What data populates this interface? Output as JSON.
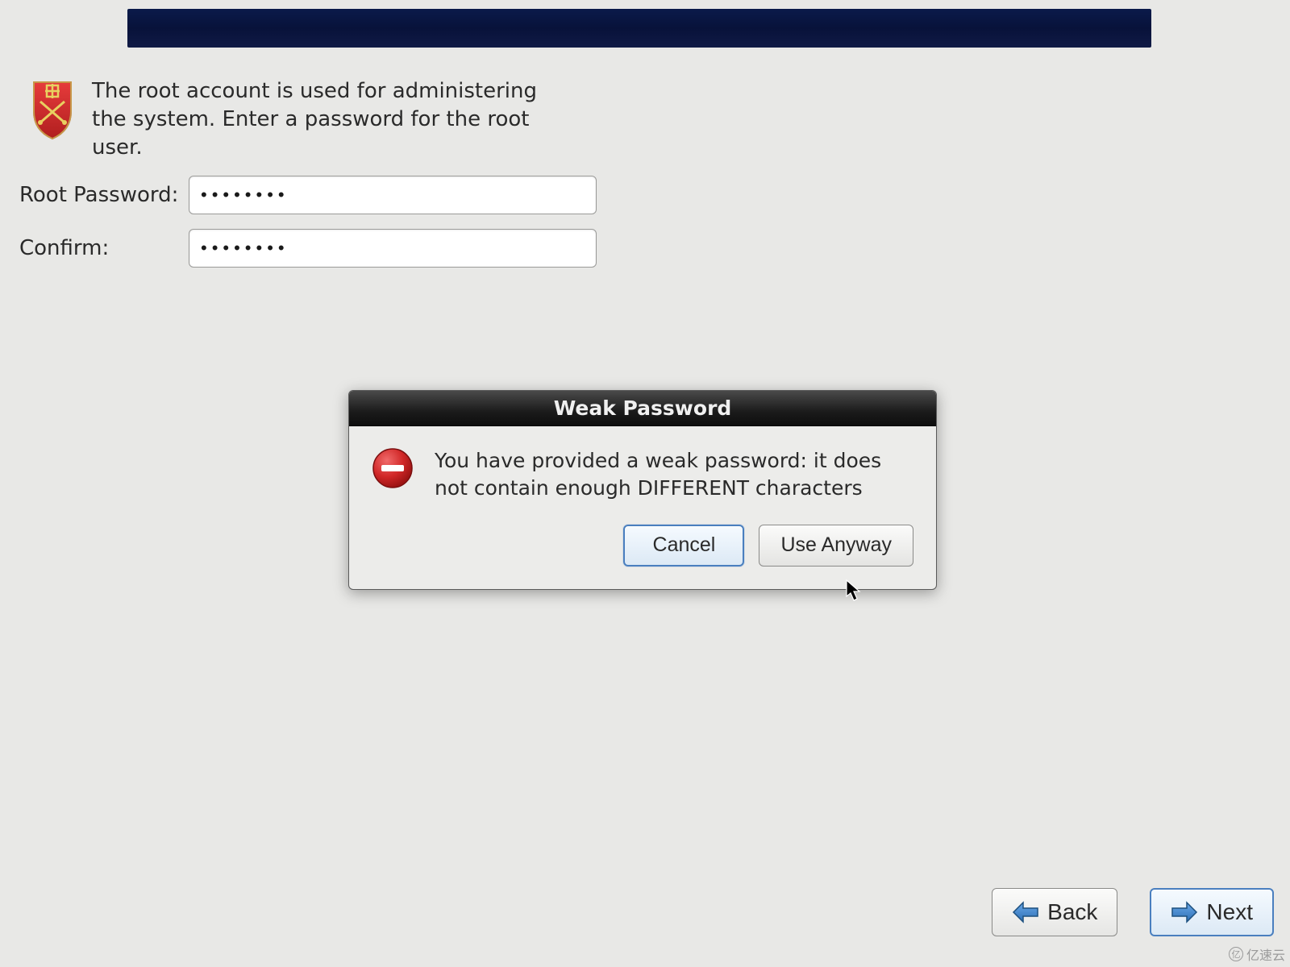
{
  "header": {
    "instruction": "The root account is used for administering the system.  Enter a password for the root user."
  },
  "form": {
    "root_password_label": "Root Password:",
    "confirm_label": "Confirm:",
    "root_password_value": "••••••••",
    "confirm_value": "••••••••"
  },
  "dialog": {
    "title": "Weak Password",
    "message": "You have provided a weak password: it does not contain enough DIFFERENT characters",
    "cancel_label": "Cancel",
    "use_anyway_label": "Use Anyway"
  },
  "nav": {
    "back_label": "Back",
    "next_label": "Next"
  },
  "watermark": {
    "text": "亿速云"
  }
}
